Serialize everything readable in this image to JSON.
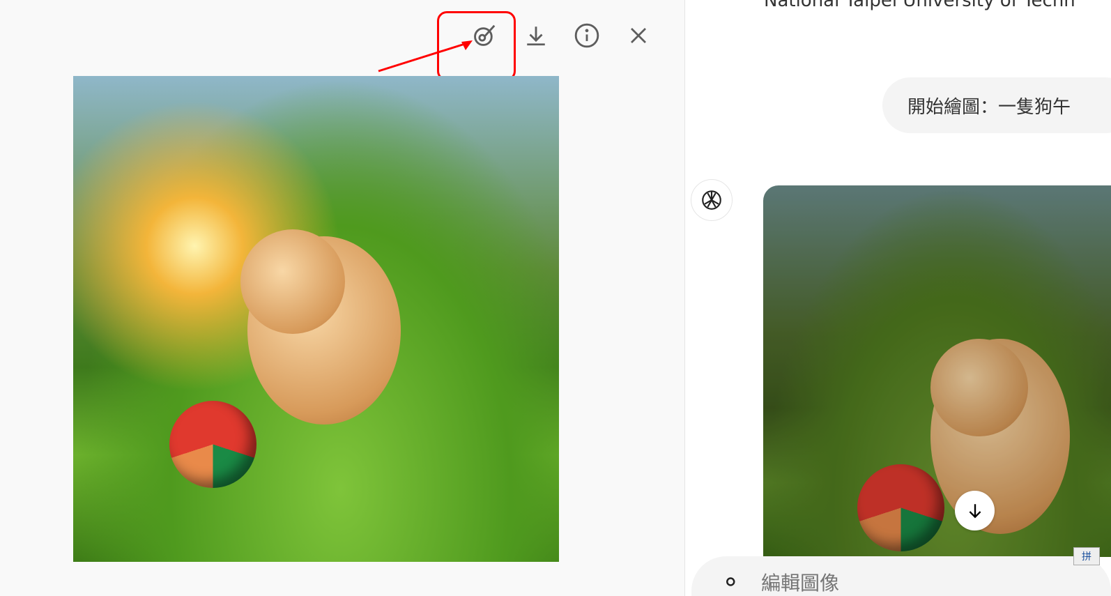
{
  "viewer": {
    "toolbar": {
      "edit_icon": "brush-edit-icon",
      "download_icon": "download-icon",
      "info_icon": "info-icon",
      "close_icon": "close-icon"
    },
    "annotation_color": "#ff0000"
  },
  "chat": {
    "previous_text": "National Taipei University of Techn",
    "user_message": "開始繪圖：一隻狗午",
    "assistant_avatar_icon": "openai-logo-icon",
    "scroll_down_icon": "arrow-down-icon",
    "composer": {
      "placeholder": "編輯圖像",
      "attach_icon": "paperclip-icon"
    },
    "ime_indicator": "拼"
  }
}
